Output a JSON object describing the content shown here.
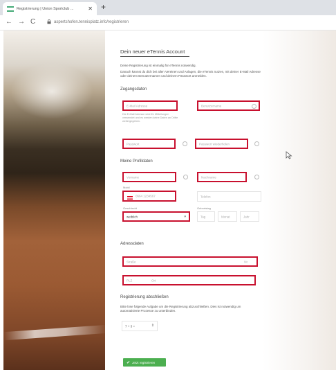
{
  "browser": {
    "tab_title": "Registrierung | Union Sportclub ...",
    "tab_close": "✕",
    "new_tab": "+",
    "url": "aspertshofen.tennisplatz.info/registrieren",
    "nav_back": "←",
    "nav_forward": "→",
    "nav_reload": "C"
  },
  "form": {
    "title": "Dein neuer eTennis Account",
    "intro_1": "Deine Registrierung ist einmalig für eTennis notwendig.",
    "intro_2": "Danach kannst du dich bei allen Vereinen und Anlagen, die eTennis nutzen, mit deiner E-Mail Adresse oder deinem Benutzernamen und deinem Passwort anmelden.",
    "section_access": "Zugangsdaten",
    "email_ph": "E-Mail Adresse",
    "username_ph": "Benutzername",
    "email_hint": "Die E-Mail Adresse wird für Mitteilungen verwendet und es werden keine Daten an Dritte weitergegeben.",
    "password_ph": "Passwort",
    "password_repeat_ph": "Passwort wiederholen",
    "section_profile": "Meine Profildaten",
    "firstname_ph": "Vorname",
    "lastname_ph": "Nachname",
    "mobile_label": "Mobil",
    "mobile_ph": "0664 1234567",
    "phone_ph": "Telefon",
    "gender_label": "Geschlecht",
    "gender_value": "weiblich",
    "birthdate_label": "Geburtstag",
    "day_ph": "Tag",
    "month_ph": "Monat",
    "year_ph": "Jahr",
    "section_address": "Adressdaten",
    "street_ph": "Straße",
    "housenumber_ph": "Nr.",
    "zip_ph": "PLZ",
    "city_ph": "Ort",
    "section_finish": "Registrierung abschließen",
    "finish_text": "Bitte löse folgende Aufgabe um die Registrierung abzuschließen. Dies ist notwendig um automatisierte Prozesse zu unterbinden.",
    "captcha": "7 + 3 =",
    "submit_label": "Jetzt registrieren",
    "check_glyph": "✔"
  },
  "colors": {
    "highlight": "#c8102e",
    "submit": "#4caf50"
  }
}
